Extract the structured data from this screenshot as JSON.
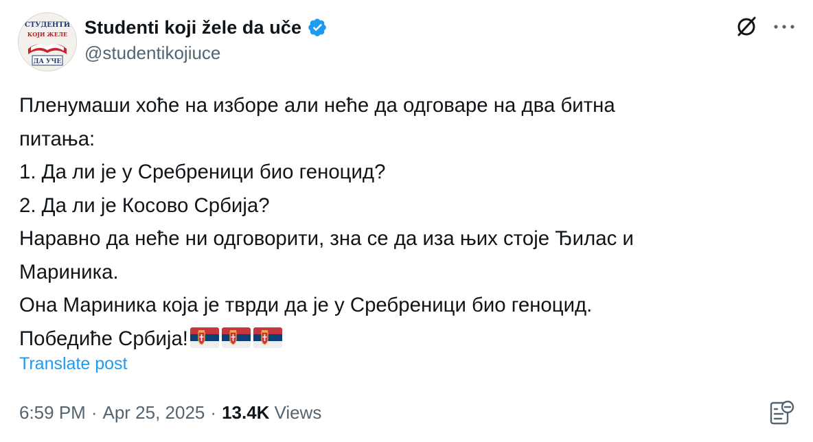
{
  "author": {
    "display_name": "Studenti koji žele da uče",
    "handle": "@studentikojiuce",
    "verified": true,
    "avatar_text": [
      "СТУДЕНТИ",
      "КОЈИ ЖЕЛЕ",
      "ДА УЧЕ"
    ]
  },
  "tweet": {
    "lines": [
      "Пленумаши хоће на изборе али неће да одговаре на два битна",
      "питања:",
      "1. Да ли је у Сребреници био геноцид?",
      "2. Да ли је Косово Србија?",
      "Наравно да неће ни одговорити, зна се да иза њих стоје Ђилас и",
      "Мариника.",
      "Она Мариника која је тврди да је у Сребреници био геноцид.",
      "Победиће Србија!"
    ],
    "flag_emojis": [
      "serbia-flag",
      "serbia-flag",
      "serbia-flag"
    ],
    "translate_label": "Translate post"
  },
  "meta": {
    "time": "6:59 PM",
    "separator": "·",
    "date": "Apr 25, 2025",
    "views_count": "13.4K",
    "views_label": "Views"
  },
  "icons": {
    "grok": "grok-icon",
    "more": "more-icon",
    "analytics": "analytics-icon",
    "verified": "verified-badge-icon"
  },
  "colors": {
    "verified_blue": "#1d9bf0",
    "link_blue": "#1d9bf0",
    "secondary_text": "#536471",
    "primary_text": "#0f1419",
    "flag_red": "#c6363c",
    "flag_blue": "#0c4076",
    "flag_white": "#ffffff"
  }
}
